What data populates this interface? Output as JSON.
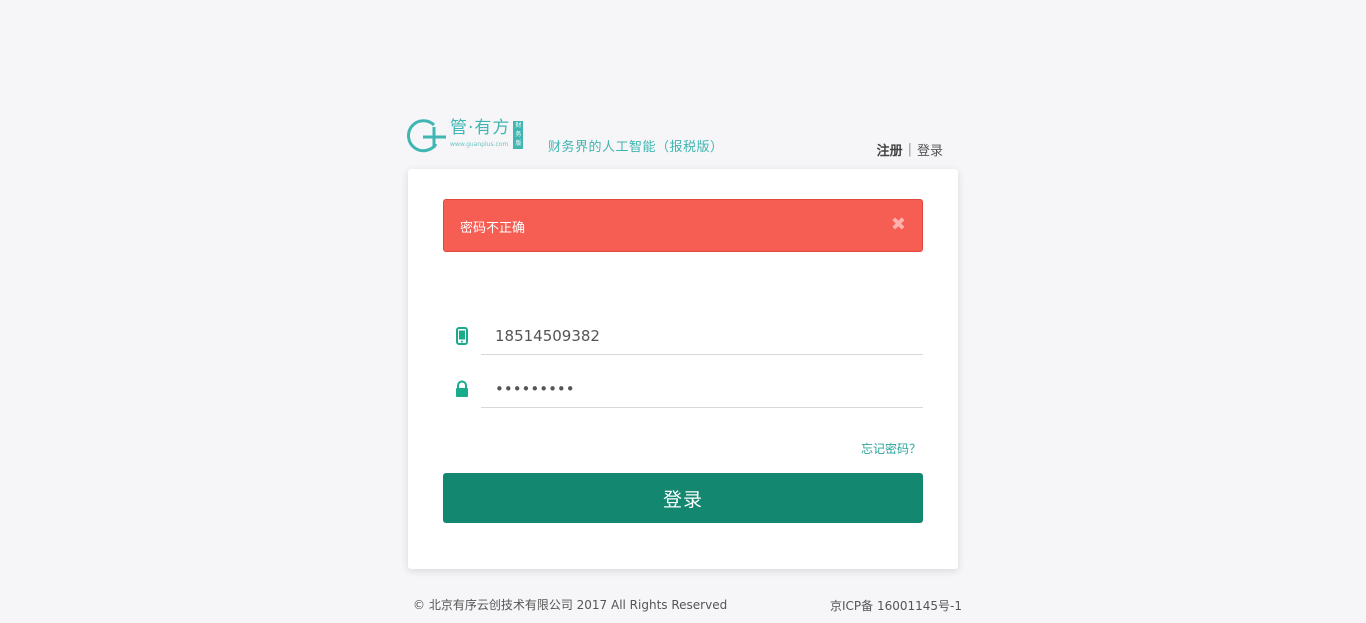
{
  "header": {
    "logo_name": "管·有方",
    "logo_url": "www.guanplus.com",
    "logo_badge": "财务版",
    "tagline": "财务界的人工智能（报税版）",
    "register_label": "注册",
    "separator": "|",
    "login_label": "登录"
  },
  "alert": {
    "message": "密码不正确",
    "close_symbol": "✖"
  },
  "form": {
    "phone_value": "18514509382",
    "password_value": "•••••••••",
    "forgot_label": "忘记密码？",
    "submit_label": "登录"
  },
  "footer": {
    "copyright": "© 北京有序云创技术有限公司 2017 All Rights Reserved",
    "icp": "京ICP备 16001145号-1"
  },
  "colors": {
    "brand": "#3fb6b2",
    "primary_button": "#138770",
    "alert_bg": "#f65d53",
    "link": "#2aa59a"
  }
}
